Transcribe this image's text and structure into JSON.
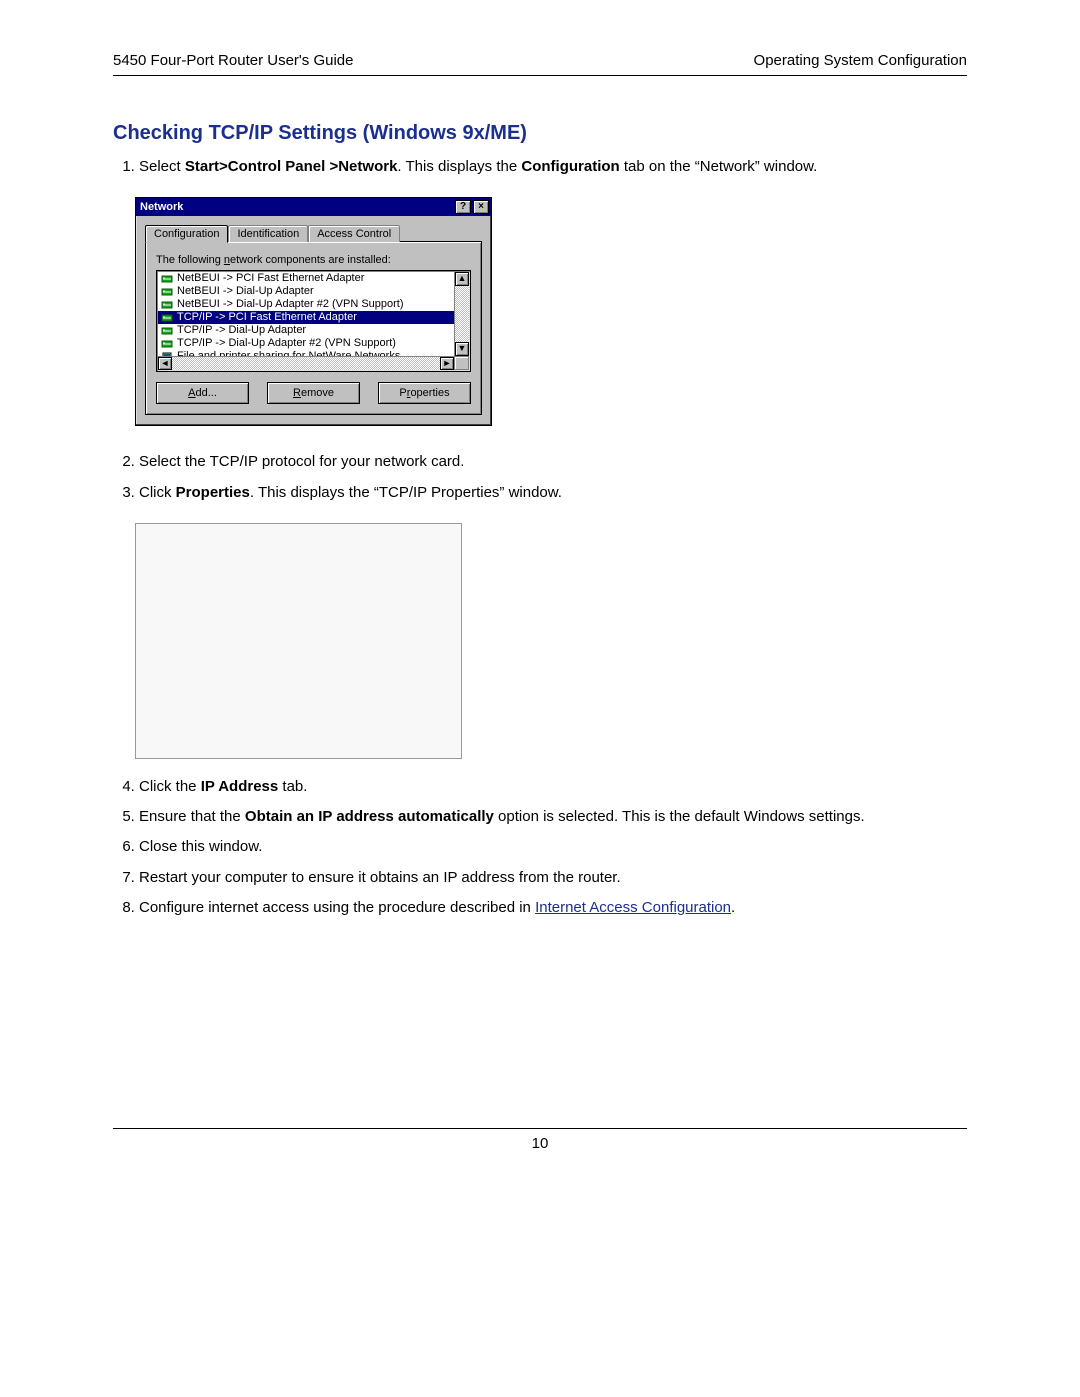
{
  "header": {
    "left": "5450 Four-Port Router User's Guide",
    "right": "Operating System Configuration"
  },
  "heading": "Checking TCP/IP Settings (Windows 9x/ME)",
  "steps": {
    "s1_pre": "Select ",
    "s1_bold": "Start>Control Panel >Network",
    "s1_post1": ". This displays the ",
    "s1_bold2": "Configuration",
    "s1_post2": " tab on the “Network” window.",
    "s2": "Select the TCP/IP protocol for your network card.",
    "s3_pre": "Click ",
    "s3_bold": "Properties",
    "s3_post": ". This displays the “TCP/IP Properties” window.",
    "s4_pre": "Click the ",
    "s4_bold": "IP Address",
    "s4_post": " tab.",
    "s5_pre": "Ensure that the ",
    "s5_bold": "Obtain an IP address automatically",
    "s5_post": " option is selected. This is the default Windows settings.",
    "s6": "Close this window.",
    "s7": "Restart your computer to ensure it obtains an IP address from the router.",
    "s8_pre": "Configure internet access using the procedure described in ",
    "s8_link": "Internet Access Configuration",
    "s8_post": "."
  },
  "dialog": {
    "title": "Network",
    "help_glyph": "?",
    "close_glyph": "×",
    "tabs": [
      "Configuration",
      "Identification",
      "Access Control"
    ],
    "active_tab": 0,
    "label_pre": "The following ",
    "label_u": "n",
    "label_post": "etwork components are installed:",
    "items": [
      {
        "icon": "proto",
        "text": "NetBEUI -> PCI Fast Ethernet Adapter",
        "selected": false
      },
      {
        "icon": "proto",
        "text": "NetBEUI -> Dial-Up Adapter",
        "selected": false
      },
      {
        "icon": "proto",
        "text": "NetBEUI -> Dial-Up Adapter #2 (VPN Support)",
        "selected": false
      },
      {
        "icon": "proto",
        "text": "TCP/IP -> PCI Fast Ethernet Adapter",
        "selected": true
      },
      {
        "icon": "proto",
        "text": "TCP/IP -> Dial-Up Adapter",
        "selected": false
      },
      {
        "icon": "proto",
        "text": "TCP/IP -> Dial-Up Adapter #2 (VPN Support)",
        "selected": false
      },
      {
        "icon": "server",
        "text": "File and printer sharing for NetWare Networks",
        "selected": false
      }
    ],
    "buttons": {
      "add_u": "A",
      "add_rest": "dd...",
      "remove_u": "R",
      "remove_rest": "emove",
      "props_pre": "P",
      "props_u": "r",
      "props_rest": "operties"
    },
    "scroll": {
      "up": "▲",
      "down": "▼",
      "left": "◄",
      "right": "►"
    }
  },
  "page_number": "10"
}
